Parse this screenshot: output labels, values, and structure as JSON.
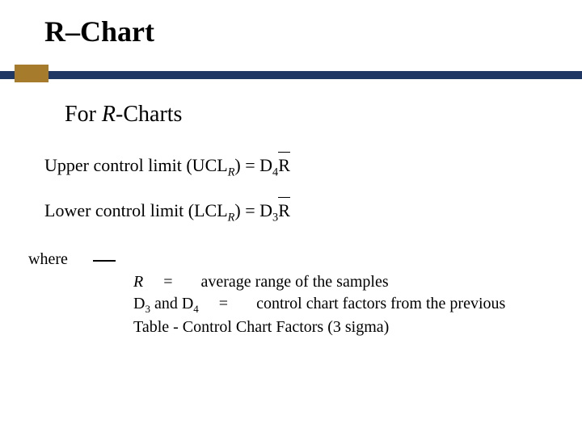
{
  "title": "R–Chart",
  "subtitle_prefix": "For ",
  "subtitle_mainvar": "R",
  "subtitle_suffix": "-Charts",
  "ucl": {
    "label_prefix": "Upper control limit (UCL",
    "label_sub": "R",
    "label_mid": ") = D",
    "label_sub2": "4",
    "var": "R"
  },
  "lcl": {
    "label_prefix": "Lower control limit (LCL",
    "label_sub": "R",
    "label_mid": ") = D",
    "label_sub2": "3",
    "var": "R"
  },
  "where_label": "where",
  "def_r_var": "R",
  "def_r_eq": "=",
  "def_r_text": "average range of the samples",
  "def_d_prefix": "D",
  "def_d_sub1": "3",
  "def_d_and": " and D",
  "def_d_sub2": "4",
  "def_d_eq": "=",
  "def_d_text": "control chart factors from the previous Table -  Control Chart Factors (3 sigma)"
}
